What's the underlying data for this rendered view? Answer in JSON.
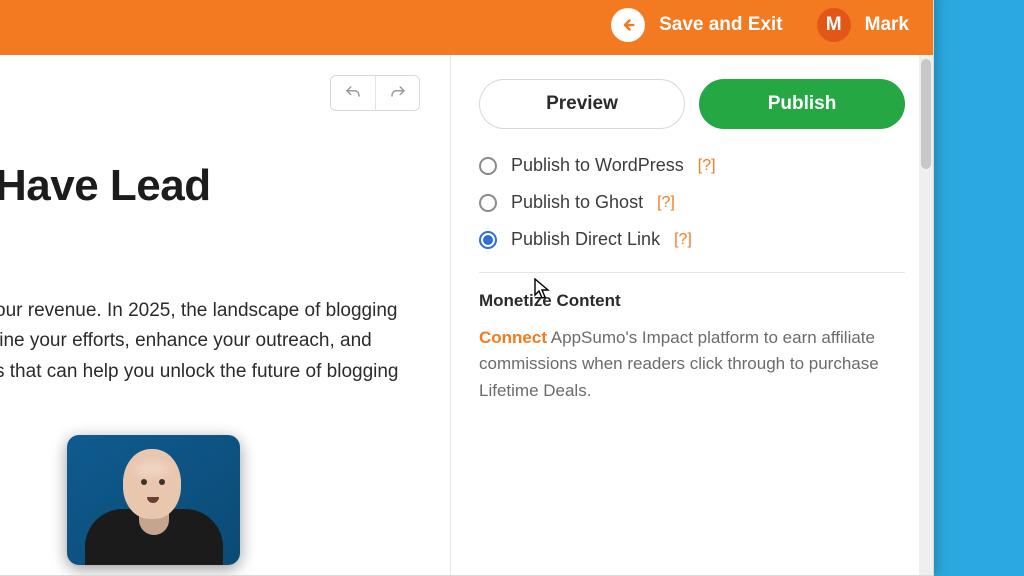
{
  "header": {
    "save_exit_label": "Save and Exit",
    "user_initial": "M",
    "user_name": "Mark"
  },
  "editor": {
    "title": "Have Lead",
    "body": "our revenue. In 2025, the landscape of blogging\nline your efforts, enhance your outreach, and\ns that can help you unlock the future of blogging"
  },
  "panel": {
    "preview_label": "Preview",
    "publish_label": "Publish",
    "options": [
      {
        "label": "Publish to WordPress",
        "help": "[?]",
        "checked": false
      },
      {
        "label": "Publish to Ghost",
        "help": "[?]",
        "checked": false
      },
      {
        "label": "Publish Direct Link",
        "help": "[?]",
        "checked": true
      }
    ],
    "monetize_title": "Monetize Content",
    "monetize_connect": "Connect",
    "monetize_body": " AppSumo's Impact platform to earn affiliate commissions when readers click through to purchase Lifetime Deals."
  }
}
